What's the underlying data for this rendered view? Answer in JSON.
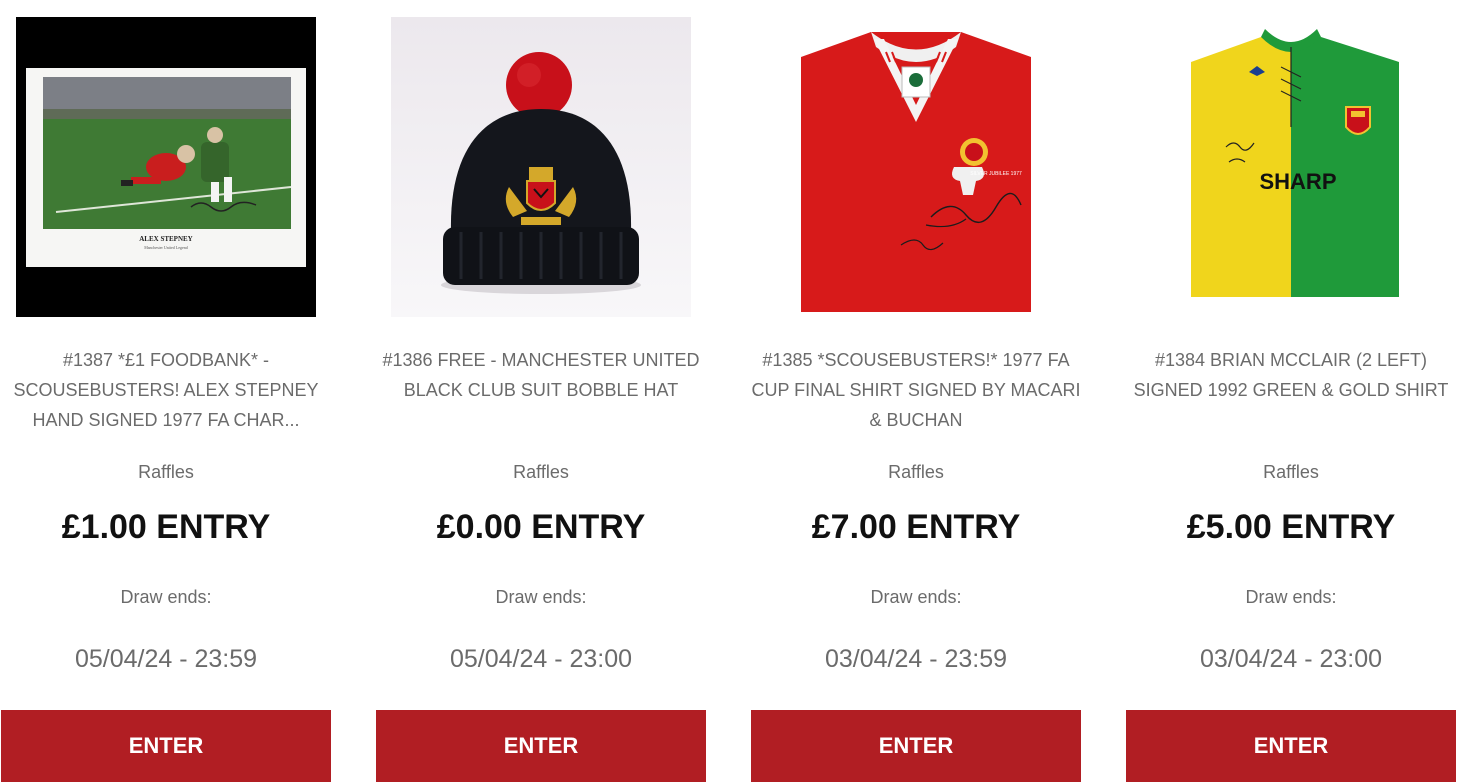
{
  "brand": {
    "button_color": "#b11e23"
  },
  "cards": [
    {
      "title": "#1387 *£1 FOODBANK* - SCOUSEBUSTERS! ALEX STEPNEY HAND SIGNED 1977 FA CHAR...",
      "category": "Raffles",
      "price": "£1.00 ENTRY",
      "draw_label": "Draw ends:",
      "draw_date": "05/04/24 - 23:59",
      "button": "ENTER",
      "image": {
        "type": "framed-photo-print",
        "caption": "ALEX STEPNEY",
        "subcaption": "Manchester United Legend"
      }
    },
    {
      "title": "#1386 FREE - MANCHESTER UNITED BLACK CLUB SUIT BOBBLE HAT",
      "category": "Raffles",
      "price": "£0.00 ENTRY",
      "draw_label": "Draw ends:",
      "draw_date": "05/04/24 - 23:00",
      "button": "ENTER",
      "image": {
        "type": "bobble-hat"
      }
    },
    {
      "title": "#1385 *SCOUSEBUSTERS!* 1977 FA CUP FINAL SHIRT SIGNED BY MACARI & BUCHAN",
      "category": "Raffles",
      "price": "£7.00 ENTRY",
      "draw_label": "Draw ends:",
      "draw_date": "03/04/24 - 23:59",
      "button": "ENTER",
      "image": {
        "type": "red-shirt",
        "badge_text": "SILVER JUBILEE 1977"
      }
    },
    {
      "title": "#1384 BRIAN MCCLAIR (2 LEFT) SIGNED 1992 GREEN & GOLD SHIRT",
      "category": "Raffles",
      "price": "£5.00 ENTRY",
      "draw_label": "Draw ends:",
      "draw_date": "03/04/24 - 23:00",
      "button": "ENTER",
      "image": {
        "type": "green-gold-shirt",
        "sponsor": "SHARP"
      }
    }
  ]
}
